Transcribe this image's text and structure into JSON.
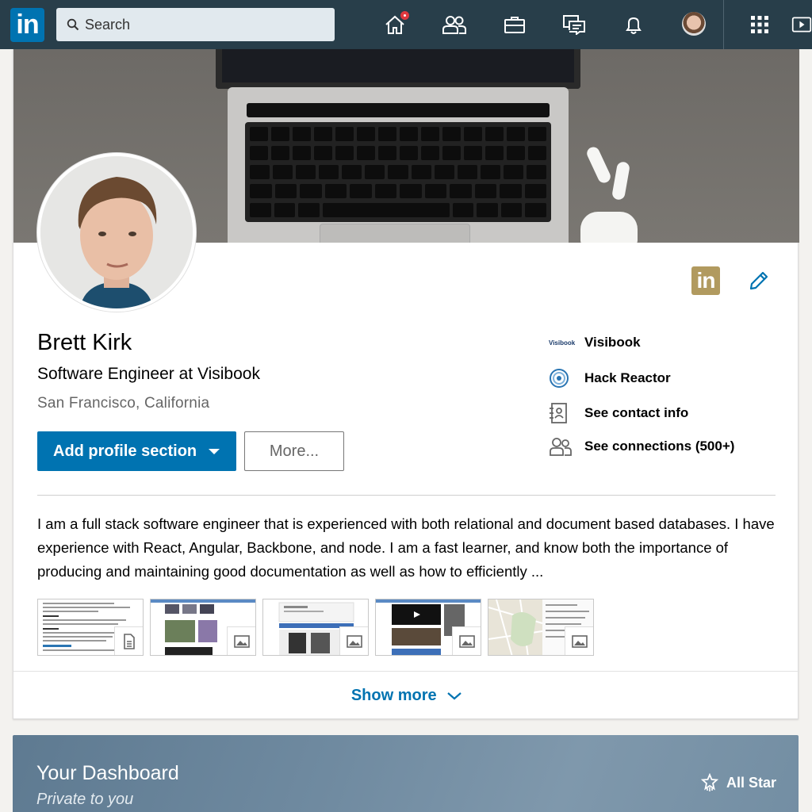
{
  "nav": {
    "logo_text": "in",
    "search_placeholder": "Search",
    "icons": [
      "home-icon",
      "my-network-icon",
      "jobs-icon",
      "messaging-icon",
      "notifications-icon",
      "me-avatar",
      "apps-grid-icon",
      "learning-icon"
    ],
    "accent": "#283e4a",
    "badge_color": "#e0383e"
  },
  "profile": {
    "name": "Brett Kirk",
    "headline": "Software Engineer at Visibook",
    "location": "San Francisco, California",
    "badge_text": "in",
    "add_section_label": "Add profile section",
    "more_label": "More...",
    "side": {
      "company_logo_text": "Visibook",
      "company": "Visibook",
      "school": "Hack Reactor",
      "contact": "See contact info",
      "connections": "See connections (500+)"
    },
    "summary": "I am a full stack software engineer that is experienced with both relational and document based databases. I have experience with React, Angular, Backbone, and node. I am a fast learner, and know both the importance of producing and maintaining good documentation as well as how to efficiently ...",
    "media": [
      {
        "kind": "document-icon"
      },
      {
        "kind": "image-icon"
      },
      {
        "kind": "image-icon"
      },
      {
        "kind": "image-icon"
      },
      {
        "kind": "image-icon"
      }
    ],
    "show_more_label": "Show more",
    "primary_color": "#0073b1"
  },
  "dashboard": {
    "title": "Your Dashboard",
    "subtitle": "Private to you",
    "all_star_label": "All Star"
  }
}
